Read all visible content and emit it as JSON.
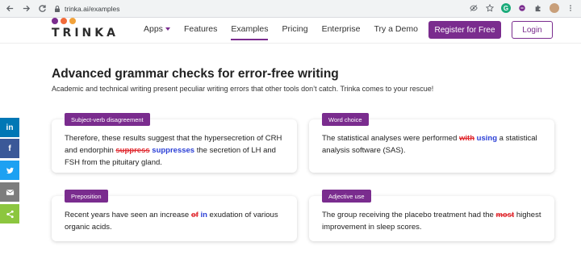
{
  "browser": {
    "url": "trinka.ai/examples",
    "profile_initial": "G"
  },
  "header": {
    "logo_text": "TRINKA",
    "logo_dot_colors": [
      "#7a2c8e",
      "#f26b3a",
      "#f2a23a"
    ],
    "nav": [
      {
        "label": "Apps"
      },
      {
        "label": "Features"
      },
      {
        "label": "Examples"
      },
      {
        "label": "Pricing"
      },
      {
        "label": "Enterprise"
      },
      {
        "label": "Try a Demo"
      }
    ],
    "register_label": "Register for Free",
    "login_label": "Login"
  },
  "main": {
    "title": "Advanced grammar checks for error-free writing",
    "subtitle": "Academic and technical writing present peculiar writing errors that other tools don’t catch. Trinka comes to your rescue!",
    "cards": [
      {
        "tag": "Subject-verb disagreement",
        "before": "Therefore, these results suggest that the hypersecretion of CRH and endorphin ",
        "wrong": "suppress",
        "fix": "suppresses",
        "after": " the secretion of LH and FSH from the pituitary gland."
      },
      {
        "tag": "Word choice",
        "before": "The statistical analyses were performed ",
        "wrong": "with",
        "fix": "using",
        "after": " a statistical analysis software (SAS)."
      },
      {
        "tag": "Preposition",
        "before": "Recent years have seen an increase ",
        "wrong": "of",
        "fix": "in",
        "after": " exudation of various organic acids."
      },
      {
        "tag": "Adjective use",
        "before": "The group receiving the placebo treatment had the ",
        "wrong": "most",
        "fix": "",
        "after": " highest improvement in sleep scores."
      }
    ]
  },
  "social": [
    {
      "icon": "linkedin-icon",
      "color": "#0077b5"
    },
    {
      "icon": "facebook-icon",
      "color": "#3b5998"
    },
    {
      "icon": "twitter-icon",
      "color": "#1da1f2"
    },
    {
      "icon": "email-icon",
      "color": "#7d7d7d"
    },
    {
      "icon": "share-icon",
      "color": "#8cc63f"
    }
  ],
  "colors": {
    "brand": "#7a2c8e",
    "error": "#e0282e",
    "correction": "#2b3fd6"
  }
}
